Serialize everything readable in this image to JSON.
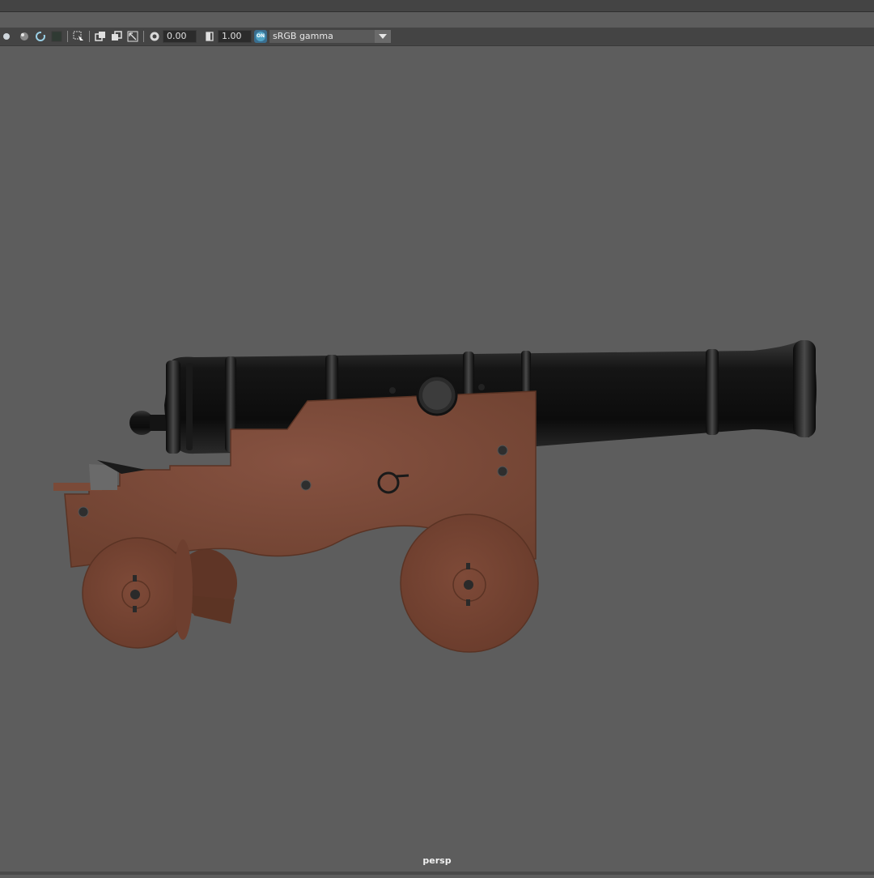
{
  "toolbar": {
    "exposure_value": "0.00",
    "gamma_value": "1.00",
    "color_mgmt_badge": "ON",
    "colorspace_selected": "sRGB gamma",
    "icons": [
      "display-icon",
      "shading-icon",
      "refresh-icon",
      "region-icon",
      "select-icon",
      "copy-icon",
      "overlay-icon",
      "resize-icon",
      "exposure-icon",
      "gamma-icon"
    ]
  },
  "viewport": {
    "camera_label": "persp",
    "background_color": "#5d5d5d"
  },
  "colors": {
    "barrel": "#1e1e1e",
    "wood": "#7a4a38",
    "toolbar_bg": "#444444",
    "accent": "#4fa3c6"
  }
}
